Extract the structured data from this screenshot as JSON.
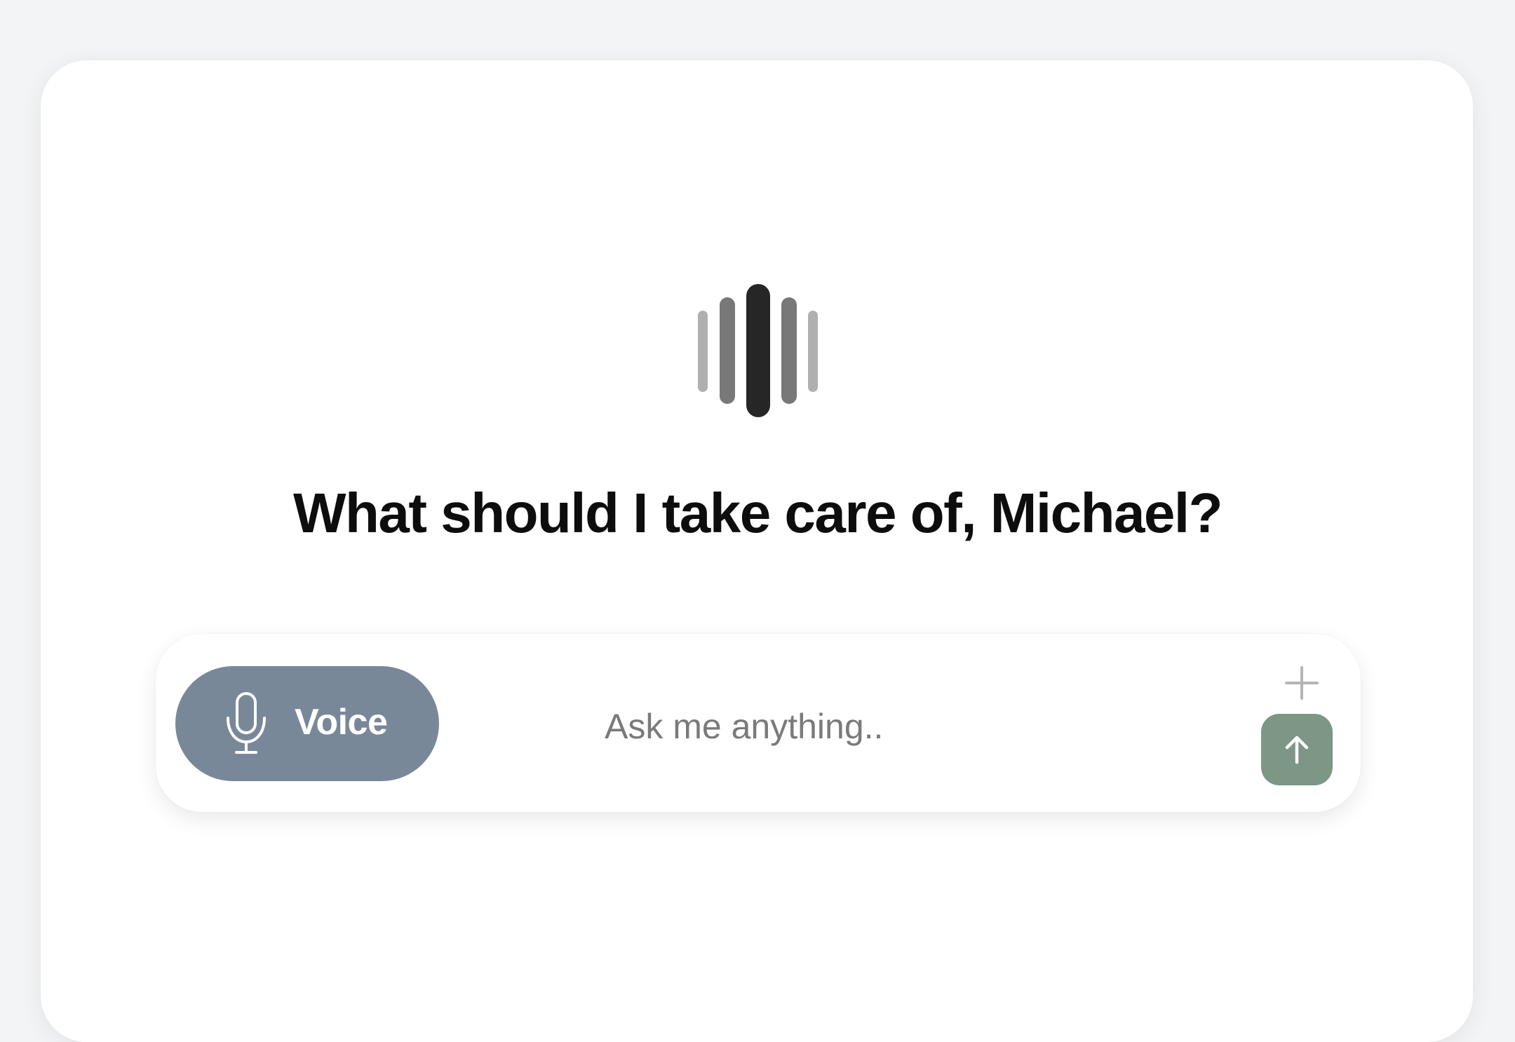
{
  "assistant": {
    "icon": "waveform-icon",
    "greeting": "What should I take care of, Michael?"
  },
  "composer": {
    "voice_label": "Voice",
    "voice_icon": "microphone-icon",
    "placeholder": "Ask me anything..",
    "value": "",
    "add_icon": "plus-icon",
    "send_icon": "arrow-up-icon"
  },
  "colors": {
    "background": "#f3f4f6",
    "card": "#ffffff",
    "voice_button": "#798899",
    "send_button": "#7d9686",
    "wave_dark": "#262626",
    "wave_mid": "#787878",
    "wave_light": "#b0b0b0"
  }
}
